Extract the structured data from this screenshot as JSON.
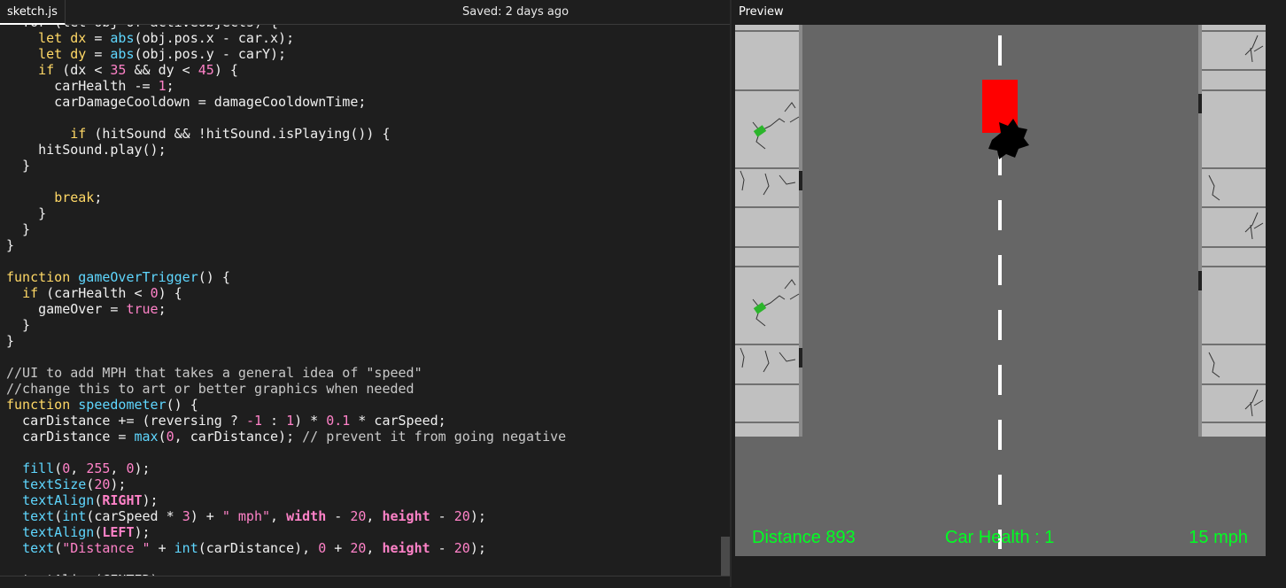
{
  "editor": {
    "file_name": "sketch.js",
    "save_status": "Saved: 2 days ago",
    "code_lines": [
      [
        [
          "",
          "  for (let obj of activeObjects) {"
        ]
      ],
      [
        [
          "",
          "    "
        ],
        [
          "kw",
          "let"
        ],
        [
          "",
          " "
        ],
        [
          "kw",
          "dx"
        ],
        [
          "",
          " = "
        ],
        [
          "fn",
          "abs"
        ],
        [
          "",
          "(obj.pos.x - car.x);"
        ]
      ],
      [
        [
          "",
          "    "
        ],
        [
          "kw",
          "let"
        ],
        [
          "",
          " "
        ],
        [
          "kw",
          "dy"
        ],
        [
          "",
          " = "
        ],
        [
          "fn",
          "abs"
        ],
        [
          "",
          "(obj.pos.y - carY);"
        ]
      ],
      [
        [
          "",
          "    "
        ],
        [
          "kw",
          "if"
        ],
        [
          "",
          " (dx < "
        ],
        [
          "num",
          "35"
        ],
        [
          "",
          " && dy < "
        ],
        [
          "num",
          "45"
        ],
        [
          "",
          ") {"
        ]
      ],
      [
        [
          "",
          "      carHealth -= "
        ],
        [
          "num",
          "1"
        ],
        [
          "",
          ";"
        ]
      ],
      [
        [
          "",
          "      carDamageCooldown = damageCooldownTime;"
        ]
      ],
      [
        [
          "",
          ""
        ]
      ],
      [
        [
          "",
          "        "
        ],
        [
          "kw",
          "if"
        ],
        [
          "",
          " (hitSound && !hitSound.isPlaying()) {"
        ]
      ],
      [
        [
          "",
          "    hitSound.play();"
        ]
      ],
      [
        [
          "",
          "  }"
        ]
      ],
      [
        [
          "",
          ""
        ]
      ],
      [
        [
          "",
          "      "
        ],
        [
          "kw",
          "break"
        ],
        [
          "",
          ";"
        ]
      ],
      [
        [
          "",
          "    }"
        ]
      ],
      [
        [
          "",
          "  }"
        ]
      ],
      [
        [
          "",
          "}"
        ]
      ],
      [
        [
          "",
          ""
        ]
      ],
      [
        [
          "kw",
          "function"
        ],
        [
          "",
          " "
        ],
        [
          "fn",
          "gameOverTrigger"
        ],
        [
          "",
          "() {"
        ]
      ],
      [
        [
          "",
          "  "
        ],
        [
          "kw",
          "if"
        ],
        [
          "",
          " (carHealth < "
        ],
        [
          "num",
          "0"
        ],
        [
          "",
          ") {"
        ]
      ],
      [
        [
          "",
          "    gameOver = "
        ],
        [
          "bool",
          "true"
        ],
        [
          "",
          ";"
        ]
      ],
      [
        [
          "",
          "  }"
        ]
      ],
      [
        [
          "",
          "}"
        ]
      ],
      [
        [
          "",
          ""
        ]
      ],
      [
        [
          "cm",
          "//UI to add MPH that takes a general idea of \"speed\""
        ]
      ],
      [
        [
          "cm",
          "//change this to art or better graphics when needed"
        ]
      ],
      [
        [
          "kw",
          "function"
        ],
        [
          "",
          " "
        ],
        [
          "fn",
          "speedometer"
        ],
        [
          "",
          "() {"
        ]
      ],
      [
        [
          "",
          "  carDistance += (reversing ? "
        ],
        [
          "num",
          "-1"
        ],
        [
          "",
          " : "
        ],
        [
          "num",
          "1"
        ],
        [
          "",
          ") * "
        ],
        [
          "num",
          "0.1"
        ],
        [
          "",
          " * carSpeed;"
        ]
      ],
      [
        [
          "",
          "  carDistance = "
        ],
        [
          "fn",
          "max"
        ],
        [
          "",
          "("
        ],
        [
          "num",
          "0"
        ],
        [
          "",
          ", carDistance); "
        ],
        [
          "cm",
          "// prevent it from going negative"
        ]
      ],
      [
        [
          "",
          ""
        ]
      ],
      [
        [
          "",
          "  "
        ],
        [
          "fn",
          "fill"
        ],
        [
          "",
          "("
        ],
        [
          "num",
          "0"
        ],
        [
          "",
          ", "
        ],
        [
          "num",
          "255"
        ],
        [
          "",
          ", "
        ],
        [
          "num",
          "0"
        ],
        [
          "",
          ");"
        ]
      ],
      [
        [
          "",
          "  "
        ],
        [
          "fn",
          "textSize"
        ],
        [
          "",
          "("
        ],
        [
          "num",
          "20"
        ],
        [
          "",
          ");"
        ]
      ],
      [
        [
          "",
          "  "
        ],
        [
          "fn",
          "textAlign"
        ],
        [
          "",
          "("
        ],
        [
          "const",
          "RIGHT"
        ],
        [
          "",
          ");"
        ]
      ],
      [
        [
          "",
          "  "
        ],
        [
          "fn",
          "text"
        ],
        [
          "",
          "("
        ],
        [
          "fn",
          "int"
        ],
        [
          "",
          "(carSpeed * "
        ],
        [
          "num",
          "3"
        ],
        [
          "",
          ") + "
        ],
        [
          "str",
          "\" mph\""
        ],
        [
          "",
          ", "
        ],
        [
          "const",
          "width"
        ],
        [
          "",
          " - "
        ],
        [
          "num",
          "20"
        ],
        [
          "",
          ", "
        ],
        [
          "const",
          "height"
        ],
        [
          "",
          " - "
        ],
        [
          "num",
          "20"
        ],
        [
          "",
          ");"
        ]
      ],
      [
        [
          "",
          "  "
        ],
        [
          "fn",
          "textAlign"
        ],
        [
          "",
          "("
        ],
        [
          "const",
          "LEFT"
        ],
        [
          "",
          ");"
        ]
      ],
      [
        [
          "",
          "  "
        ],
        [
          "fn",
          "text"
        ],
        [
          "",
          "("
        ],
        [
          "str",
          "\"Distance \""
        ],
        [
          "",
          " + "
        ],
        [
          "fn",
          "int"
        ],
        [
          "",
          "(carDistance), "
        ],
        [
          "num",
          "0"
        ],
        [
          "",
          " + "
        ],
        [
          "num",
          "20"
        ],
        [
          "",
          ", "
        ],
        [
          "const",
          "height"
        ],
        [
          "",
          " - "
        ],
        [
          "num",
          "20"
        ],
        [
          "",
          ");"
        ]
      ],
      [
        [
          "",
          ""
        ]
      ],
      [
        [
          "",
          "  textAlign(CENTER);"
        ]
      ]
    ]
  },
  "preview": {
    "label": "Preview",
    "hud": {
      "distance": "Distance 893",
      "health": "Car Health : 1",
      "speed": "15 mph"
    }
  },
  "colors": {
    "road": "#666666",
    "sidewalk": "#c0c0c0",
    "car": "#ff0000",
    "hud_text": "#00ff22"
  }
}
